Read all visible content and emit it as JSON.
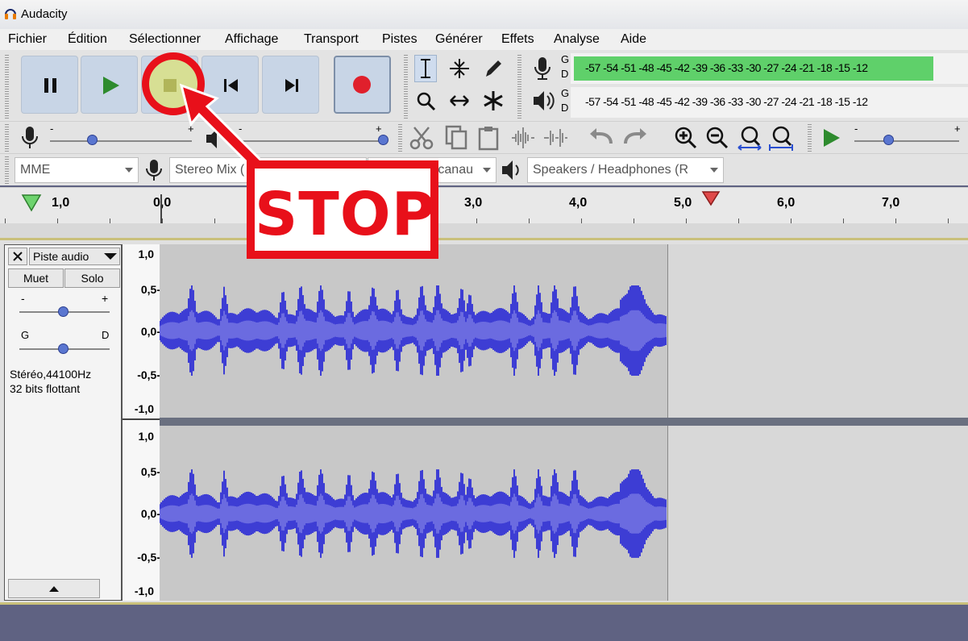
{
  "app": {
    "title": "Audacity"
  },
  "menu": [
    "Fichier",
    "Édition",
    "Sélectionner",
    "Affichage",
    "Transport",
    "Pistes",
    "Générer",
    "Effets",
    "Analyse",
    "Aide"
  ],
  "meter": {
    "channels": [
      "G",
      "D"
    ],
    "scale": [
      "-57",
      "-54",
      "-51",
      "-48",
      "-45",
      "-42",
      "-39",
      "-36",
      "-33",
      "-30",
      "-27",
      "-24",
      "-21",
      "-18",
      "-15",
      "-12"
    ],
    "recording_level_fraction": 0.92
  },
  "mixer": {
    "minus": "-",
    "plus": "+"
  },
  "device": {
    "host": "MME",
    "input": "Stereo Mix (",
    "channels": "canau",
    "output": "Speakers / Headphones (R"
  },
  "ruler": {
    "ticks": [
      "1,0",
      "0,0",
      "3,0",
      "4,0",
      "5,0",
      "6,0",
      "7,0"
    ]
  },
  "track": {
    "name": "Piste audio",
    "mute": "Muet",
    "solo": "Solo",
    "gain_minus": "-",
    "gain_plus": "+",
    "pan_left": "G",
    "pan_right": "D",
    "format_rate": "Stéréo,44100Hz",
    "format_bits": "32 bits flottant",
    "scale": [
      "1,0",
      "0,5-",
      "0,0-",
      "-0,5-",
      "-1,0"
    ],
    "scale2": [
      "1,0",
      "0,5-",
      "0,0-",
      "-0,5-",
      "-1,0"
    ]
  },
  "callout": {
    "text": "STOP"
  },
  "colors": {
    "wave": "#3d3dd4",
    "wave_light": "#6b6be0",
    "callout": "#e8101a",
    "button": "#c8d5e6"
  }
}
